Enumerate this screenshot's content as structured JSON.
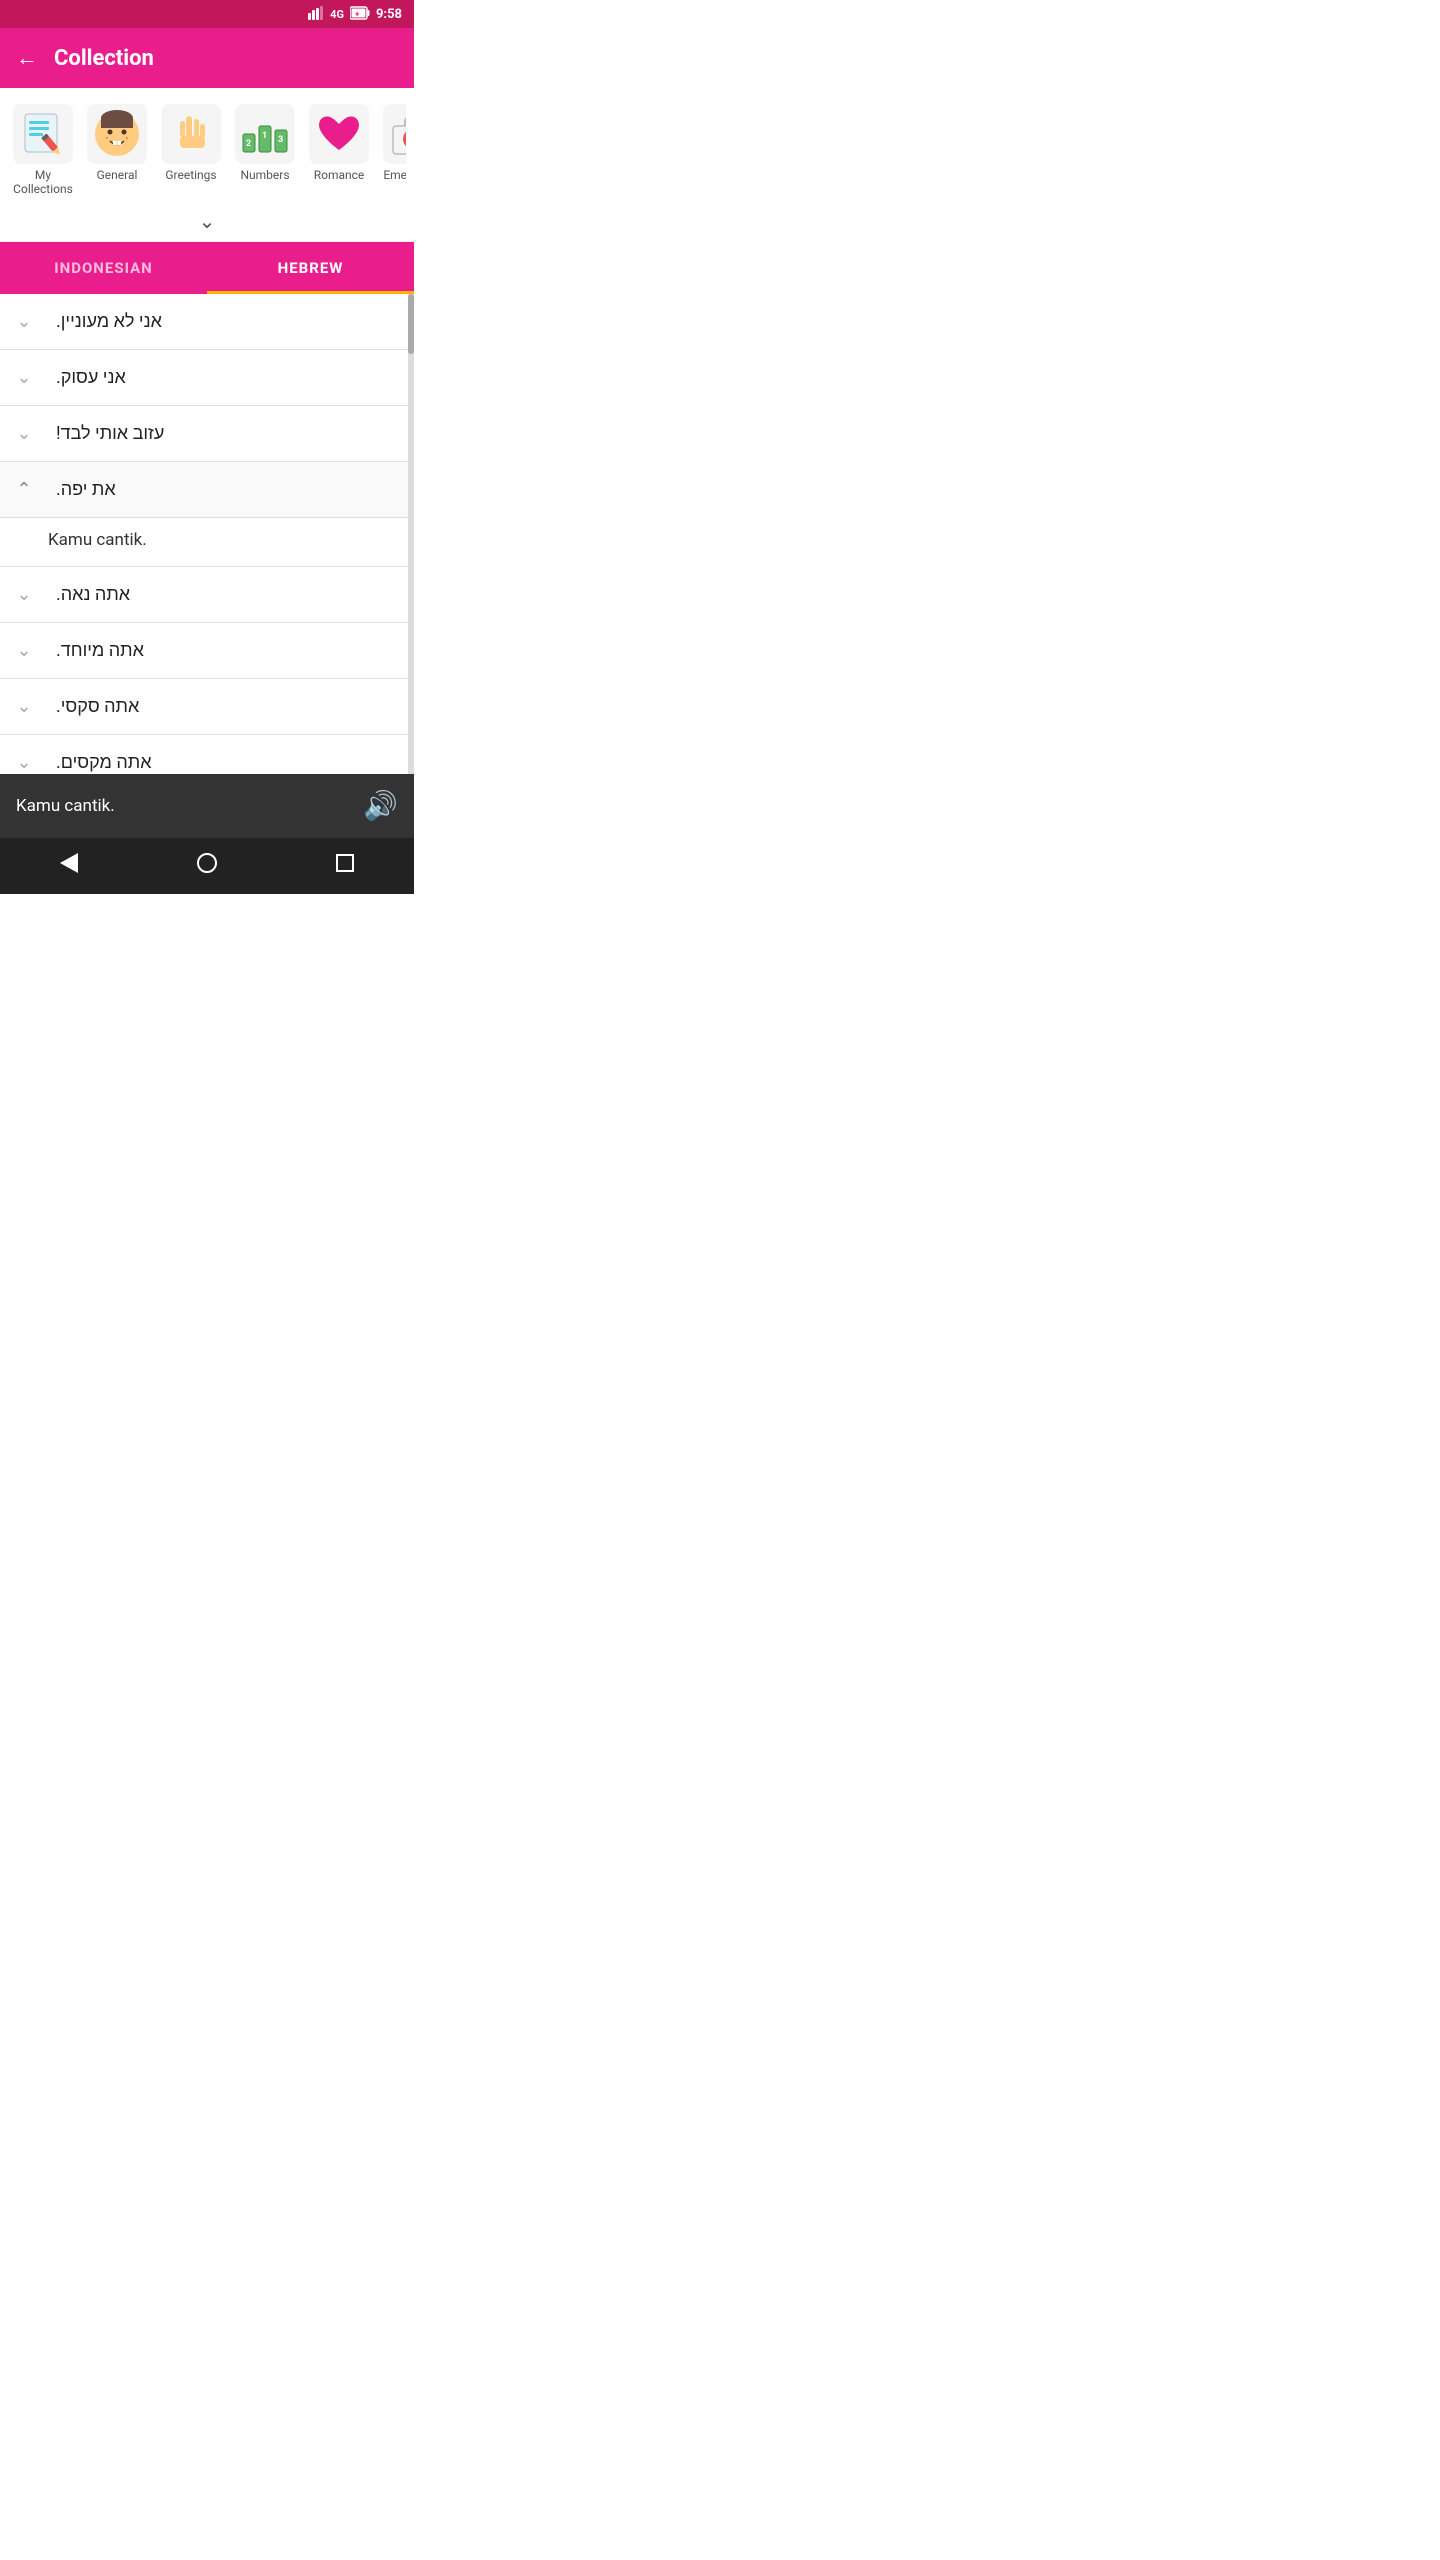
{
  "statusBar": {
    "network": "4G",
    "time": "9:58"
  },
  "header": {
    "backLabel": "←",
    "title": "Collection"
  },
  "categories": [
    {
      "id": "my-collections",
      "label": "My Collections",
      "emoji": "📝"
    },
    {
      "id": "general",
      "label": "General",
      "emoji": "🙂"
    },
    {
      "id": "greetings",
      "label": "Greetings",
      "emoji": "✋"
    },
    {
      "id": "numbers",
      "label": "Numbers",
      "emoji": "🔢"
    },
    {
      "id": "romance",
      "label": "Romance",
      "emoji": "❤️"
    },
    {
      "id": "emergency",
      "label": "Emergency",
      "emoji": "🩹"
    }
  ],
  "tabs": [
    {
      "id": "indonesian",
      "label": "INDONESIAN",
      "active": false
    },
    {
      "id": "hebrew",
      "label": "HEBREW",
      "active": true
    }
  ],
  "phrases": [
    {
      "id": "p1",
      "hebrew": "אני לא מעוניין.",
      "translation": null,
      "expanded": false
    },
    {
      "id": "p2",
      "hebrew": "אני עסוק.",
      "translation": null,
      "expanded": false
    },
    {
      "id": "p3",
      "hebrew": "עזוב אותי לבד!",
      "translation": null,
      "expanded": false
    },
    {
      "id": "p4",
      "hebrew": "את יפה.",
      "translation": "Kamu cantik.",
      "expanded": true
    },
    {
      "id": "p5",
      "hebrew": "אתה נאה.",
      "translation": null,
      "expanded": false
    },
    {
      "id": "p6",
      "hebrew": "אתה מיוחד.",
      "translation": null,
      "expanded": false
    },
    {
      "id": "p7",
      "hebrew": "אתה סקסי.",
      "translation": null,
      "expanded": false
    },
    {
      "id": "p8",
      "hebrew": "אתה מקסים.",
      "translation": null,
      "expanded": false
    }
  ],
  "bottomPlayer": {
    "text": "Kamu cantik.",
    "speakerIcon": "🔊"
  },
  "navBar": {
    "backLabel": "◀",
    "homeLabel": "⬤",
    "recentLabel": "■"
  }
}
